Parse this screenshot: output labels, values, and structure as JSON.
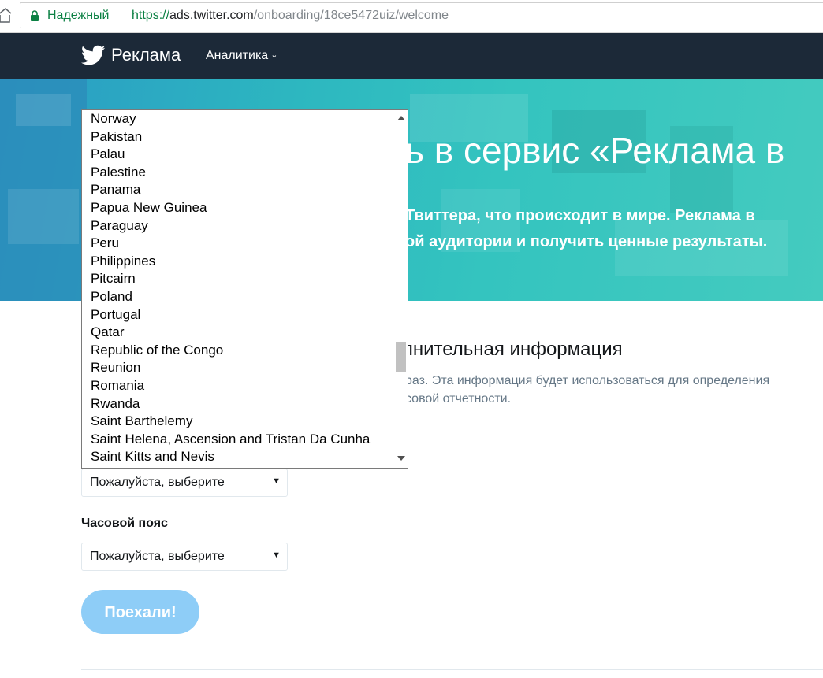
{
  "browser": {
    "security_label": "Надежный",
    "url_scheme": "https://",
    "url_host": "ads.twitter.com",
    "url_path": "/onboarding/18ce5472uiz/welcome"
  },
  "nav": {
    "brand": "Реклама",
    "analytics": "Аналитика"
  },
  "hero": {
    "title": "ь в сервис «Реклама в",
    "subtitle_line1": "Твиттера, что происходит в мире. Реклама в",
    "subtitle_line2": "ой аудитории и получить ценные результаты."
  },
  "section": {
    "title": "олнительная информация",
    "desc_line1": "раз. Эта информация будет использоваться для определения",
    "desc_line2": "совой отчетности."
  },
  "country_select": {
    "value": "Пожалуйста, выберите",
    "options": [
      "Norway",
      "Pakistan",
      "Palau",
      "Palestine",
      "Panama",
      "Papua New Guinea",
      "Paraguay",
      "Peru",
      "Philippines",
      "Pitcairn",
      "Poland",
      "Portugal",
      "Qatar",
      "Republic of the Congo",
      "Reunion",
      "Romania",
      "Rwanda",
      "Saint Barthelemy",
      "Saint Helena, Ascension and Tristan Da Cunha",
      "Saint Kitts and Nevis"
    ],
    "scroll_position": 0.66
  },
  "timezone": {
    "label": "Часовой пояс",
    "value": "Пожалуйста, выберите"
  },
  "submit": {
    "label": "Поехали!"
  },
  "colors": {
    "nav_bg": "#1c2938",
    "hero_accent": "#34c4bf",
    "button_bg": "#8ecdf7",
    "secure_green": "#0b8043"
  }
}
